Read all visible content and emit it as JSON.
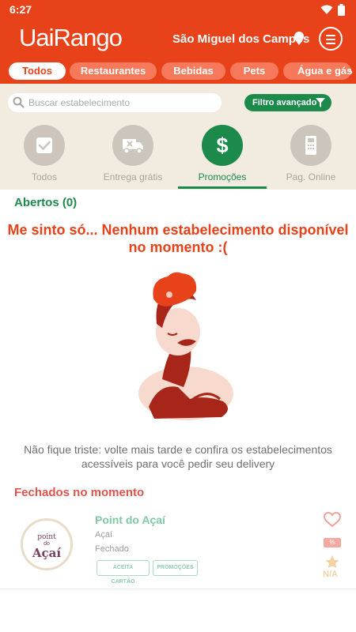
{
  "status_bar": {
    "time": "6:27"
  },
  "header": {
    "logo": "UaiRango",
    "city": "São Miguel dos Campos"
  },
  "categories": [
    {
      "label": "Todos",
      "active": true
    },
    {
      "label": "Restaurantes",
      "active": false
    },
    {
      "label": "Bebidas",
      "active": false
    },
    {
      "label": "Pets",
      "active": false
    },
    {
      "label": "Água e gás",
      "active": false
    }
  ],
  "search": {
    "placeholder": "Buscar estabelecimento",
    "value": ""
  },
  "filter_button": {
    "label": "Filtro avançado"
  },
  "filter_tabs": [
    {
      "label": "Todos",
      "icon": "check-square-icon",
      "active": false
    },
    {
      "label": "Entrega grátis",
      "icon": "delivery-truck-icon",
      "active": false
    },
    {
      "label": "Promoções",
      "icon": "dollar-icon",
      "active": true
    },
    {
      "label": "Pag. Online",
      "icon": "card-terminal-icon",
      "active": false
    }
  ],
  "open_section": {
    "title": "Abertos (0)"
  },
  "empty_state": {
    "title_line1": "Me sinto só... Nenhum estabelecimento disponível",
    "title_line2": "no momento :(",
    "text_line1": "Não fique triste: volte mais tarde e confira os estabelecimentos",
    "text_line2": "acessíveis para você pedir seu delivery"
  },
  "closed_section": {
    "title": "Fechados no momento"
  },
  "stores": [
    {
      "name": "Point do Açaí",
      "category": "Açaí",
      "status": "Fechado",
      "badges": [
        "ACEITA CARTÃO",
        "PROMOÇÕES"
      ],
      "promo_tag": "%",
      "rating": "N/A",
      "logo": {
        "top": "point",
        "middle": "do",
        "main": "Açaí"
      }
    }
  ],
  "colors": {
    "primary": "#e8421a",
    "green": "#1b8a4b",
    "beige": "#f1ebe0"
  }
}
